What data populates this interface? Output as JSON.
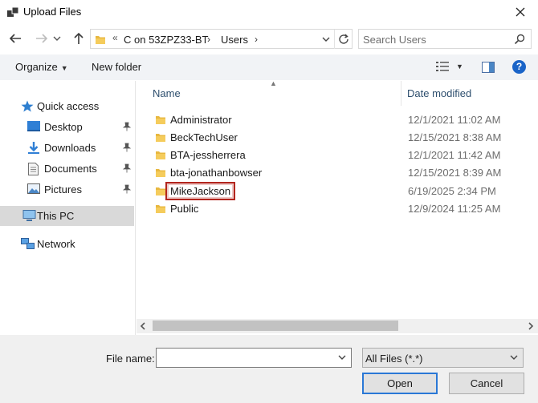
{
  "window": {
    "title": "Upload Files"
  },
  "address": {
    "overflow_glyph": "«",
    "segments": [
      "C on 53ZPZ33-BT",
      "Users"
    ],
    "separator": "›"
  },
  "search": {
    "placeholder": "Search Users"
  },
  "toolbar": {
    "organize_label": "Organize",
    "new_folder_label": "New folder",
    "help_label": "?"
  },
  "nav": {
    "quick_access": "Quick access",
    "items": [
      {
        "label": "Desktop",
        "icon": "desktop-icon",
        "pinned": true
      },
      {
        "label": "Downloads",
        "icon": "downloads-icon",
        "pinned": true
      },
      {
        "label": "Documents",
        "icon": "documents-icon",
        "pinned": true
      },
      {
        "label": "Pictures",
        "icon": "pictures-icon",
        "pinned": true
      }
    ],
    "this_pc": "This PC",
    "network": "Network"
  },
  "list": {
    "columns": {
      "name": "Name",
      "date_modified": "Date modified"
    },
    "rows": [
      {
        "name": "Administrator",
        "date": "12/1/2021 11:02 AM"
      },
      {
        "name": "BeckTechUser",
        "date": "12/15/2021 8:38 AM"
      },
      {
        "name": "BTA-jessherrera",
        "date": "12/1/2021 11:42 AM"
      },
      {
        "name": "bta-jonathanbowser",
        "date": "12/15/2021 8:39 AM"
      },
      {
        "name": "MikeJackson",
        "date": "6/19/2025 2:34 PM"
      },
      {
        "name": "Public",
        "date": "12/9/2024 11:25 AM"
      }
    ],
    "highlighted_row": "MikeJackson"
  },
  "footer": {
    "file_name_label": "File name:",
    "file_name_value": "",
    "file_type": "All Files (*.*)",
    "open_label": "Open",
    "cancel_label": "Cancel"
  },
  "colors": {
    "accent": "#1a64c8",
    "highlight_box": "#b3261e",
    "folder": "#e8b840",
    "selected_nav": "#d9d9d9"
  }
}
